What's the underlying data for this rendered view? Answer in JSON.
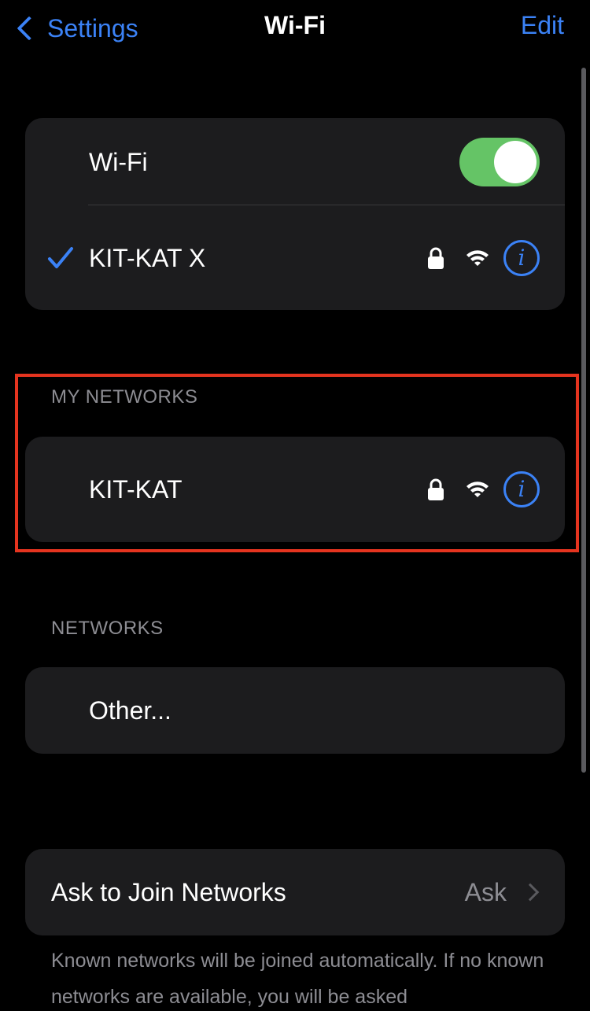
{
  "nav": {
    "back_label": "Settings",
    "title": "Wi-Fi",
    "edit_label": "Edit"
  },
  "wifi_toggle": {
    "label": "Wi-Fi",
    "on": true
  },
  "connected": {
    "name": "KIT-KAT X",
    "secured": true,
    "icons": [
      "checkmark-icon",
      "lock-icon",
      "wifi-icon",
      "info-icon"
    ]
  },
  "my_networks": {
    "header": "MY NETWORKS",
    "items": [
      {
        "name": "KIT-KAT",
        "secured": true
      }
    ]
  },
  "networks": {
    "header": "NETWORKS",
    "other_label": "Other..."
  },
  "ask_to_join": {
    "label": "Ask to Join Networks",
    "value": "Ask"
  },
  "footer_text": "Known networks will be joined automatically. If no known networks are available, you will be asked",
  "colors": {
    "background": "#000000",
    "card": "#1c1c1e",
    "accent": "#3b82f6",
    "toggle_on": "#65c466",
    "secondary_text": "#8d8d93",
    "highlight": "#e5341f"
  }
}
